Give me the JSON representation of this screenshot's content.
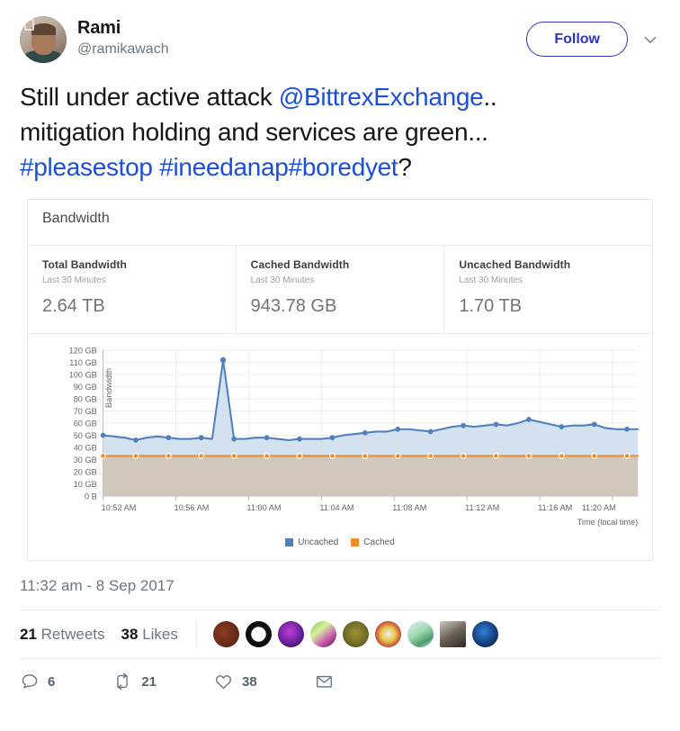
{
  "tweet": {
    "display_name": "Rami",
    "handle": "@ramikawach",
    "follow_label": "Follow",
    "caret_icon": "chevron-down-icon",
    "text_part1": "Still under active attack ",
    "mention": "@BittrexExchange",
    "text_part2": "..",
    "line2": "mitigation holding and services are green...",
    "hashtag1": "#pleasestop",
    "hashtag2": "#ineedanap",
    "hashtag3": "#boredyet",
    "text_end": "?",
    "timestamp": "11:32 am - 8 Sep 2017",
    "retweet_count": "21",
    "retweets_label": "Retweets",
    "like_count": "38",
    "likes_label": "Likes"
  },
  "actions": {
    "reply": {
      "icon": "reply-icon",
      "count": "6"
    },
    "retweet": {
      "icon": "retweet-icon",
      "count": "21"
    },
    "like": {
      "icon": "heart-icon",
      "count": "38"
    },
    "message": {
      "icon": "envelope-icon",
      "count": ""
    }
  },
  "card": {
    "title": "Bandwidth",
    "stats": [
      {
        "title": "Total Bandwidth",
        "sub": "Last 30 Minutes",
        "value": "2.64 TB"
      },
      {
        "title": "Cached Bandwidth",
        "sub": "Last 30 Minutes",
        "value": "943.78 GB"
      },
      {
        "title": "Uncached Bandwidth",
        "sub": "Last 30 Minutes",
        "value": "1.70 TB"
      }
    ]
  },
  "colors": {
    "uncached_line": "#4f81bd",
    "uncached_fill": "#cddceb",
    "cached_line": "#ed8c2b",
    "cached_fill": "#cdc5b7",
    "link": "#1b4fd8",
    "follow_border": "#2b35c4"
  },
  "chart_data": {
    "type": "area",
    "title": "",
    "xlabel": "Time (local time)",
    "ylabel": "Bandwidth",
    "ylim": [
      0,
      120
    ],
    "yunit": "GB",
    "ytick_labels": [
      "120 GB",
      "110 GB",
      "100 GB",
      "90 GB",
      "80 GB",
      "70 GB",
      "60 GB",
      "50 GB",
      "40 GB",
      "30 GB",
      "20 GB",
      "10 GB",
      "0 B"
    ],
    "ytick_values": [
      120,
      110,
      100,
      90,
      80,
      70,
      60,
      50,
      40,
      30,
      20,
      10,
      0
    ],
    "xtick_labels": [
      "10:52 AM",
      "10:56 AM",
      "11:00 AM",
      "11:04 AM",
      "11:08 AM",
      "11:12 AM",
      "11:16 AM",
      "11:20 AM"
    ],
    "xtick_minutes": [
      52,
      56,
      60,
      64,
      68,
      72,
      76,
      80
    ],
    "grid": true,
    "legend_position": "bottom",
    "stacked": true,
    "x": [
      52.0,
      52.6,
      53.2,
      53.8,
      54.4,
      55.0,
      55.6,
      56.2,
      56.8,
      57.4,
      58.0,
      58.6,
      59.2,
      59.8,
      60.4,
      61.0,
      61.6,
      62.2,
      62.8,
      63.4,
      64.0,
      64.6,
      65.2,
      65.8,
      66.4,
      67.0,
      67.6,
      68.2,
      68.8,
      69.4,
      70.0,
      70.6,
      71.2,
      71.8,
      72.4,
      73.0,
      73.6,
      74.2,
      74.8,
      75.4,
      76.0,
      76.6,
      77.2,
      77.8,
      78.4,
      79.0,
      79.6,
      80.2,
      80.8,
      81.4
    ],
    "series": [
      {
        "name": "Uncached",
        "color": "#4f81bd",
        "fill": "#cddceb",
        "values": [
          50,
          49,
          48,
          46,
          48,
          49,
          48,
          47,
          47,
          48,
          47,
          112,
          47,
          47,
          48,
          48,
          47,
          46,
          47,
          47,
          47,
          48,
          50,
          51,
          52,
          53,
          53,
          55,
          55,
          54,
          53,
          55,
          57,
          58,
          57,
          58,
          59,
          58,
          60,
          63,
          61,
          59,
          57,
          58,
          58,
          59,
          56,
          55,
          55,
          55
        ]
      },
      {
        "name": "Cached",
        "color": "#ed8c2b",
        "fill": "#cdc5b7",
        "values": [
          33,
          33,
          33,
          33,
          33,
          33,
          33,
          33,
          33,
          33,
          33,
          33,
          33,
          33,
          33,
          33,
          33,
          33,
          33,
          33,
          33,
          33,
          33,
          33,
          33,
          33,
          33,
          33,
          33,
          33,
          33,
          33,
          33,
          33,
          33,
          33,
          33,
          33,
          33,
          33,
          33,
          33,
          33,
          33,
          33,
          33,
          33,
          33,
          33,
          33
        ]
      }
    ],
    "legend": [
      "Uncached",
      "Cached"
    ]
  }
}
